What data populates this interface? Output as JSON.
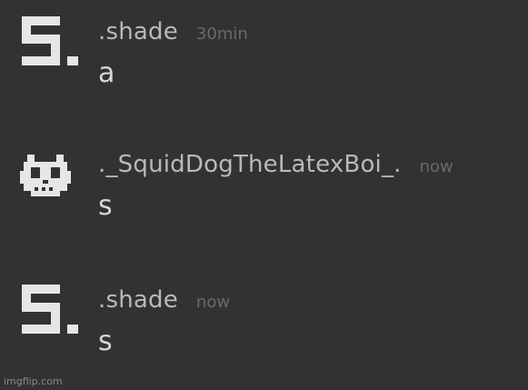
{
  "messages": [
    {
      "username": ".shade",
      "timestamp": "30min",
      "text": "a",
      "avatar_icon": "pixel-s-icon"
    },
    {
      "username": "._SquidDogTheLatexBoi_.",
      "timestamp": "now",
      "text": "s",
      "avatar_icon": "pixel-dog-skull-icon"
    },
    {
      "username": ".shade",
      "timestamp": "now",
      "text": "s",
      "avatar_icon": "pixel-s-icon"
    }
  ],
  "watermark": "imgflip.com",
  "colors": {
    "background": "#323232",
    "username": "#b9b9b9",
    "timestamp": "#6a6a6a",
    "message_text": "#d6d6d6",
    "avatar": "#e6e6e6"
  }
}
